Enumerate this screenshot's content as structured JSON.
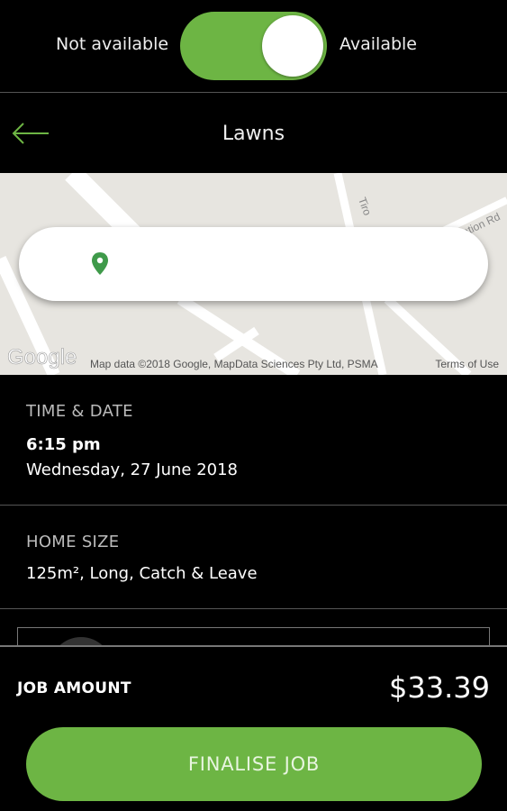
{
  "availability": {
    "left_label": "Not available",
    "right_label": "Available",
    "is_available": true,
    "toggle_color": "#6db544"
  },
  "header": {
    "title": "Lawns",
    "back_icon": "arrow-left-icon",
    "back_icon_color": "#6db544"
  },
  "map": {
    "logo_text": "Google",
    "attribution": "Map data ©2018 Google, MapData Sciences Pty Ltd, PSMA",
    "terms": "Terms of Use",
    "street_labels": [
      "Tiro",
      "ation Rd"
    ],
    "location_icon": "map-pin-icon",
    "pin_color": "#3f9a4a"
  },
  "time_date": {
    "label": "TIME & DATE",
    "time": "6:15 pm",
    "date": "Wednesday, 27 June 2018"
  },
  "home_size": {
    "label": "HOME SIZE",
    "value": "125m², Long, Catch & Leave"
  },
  "job": {
    "amount_label": "JOB AMOUNT",
    "amount": "$33.39",
    "finalise_label": "FINALISE JOB",
    "accent": "#6db544"
  }
}
